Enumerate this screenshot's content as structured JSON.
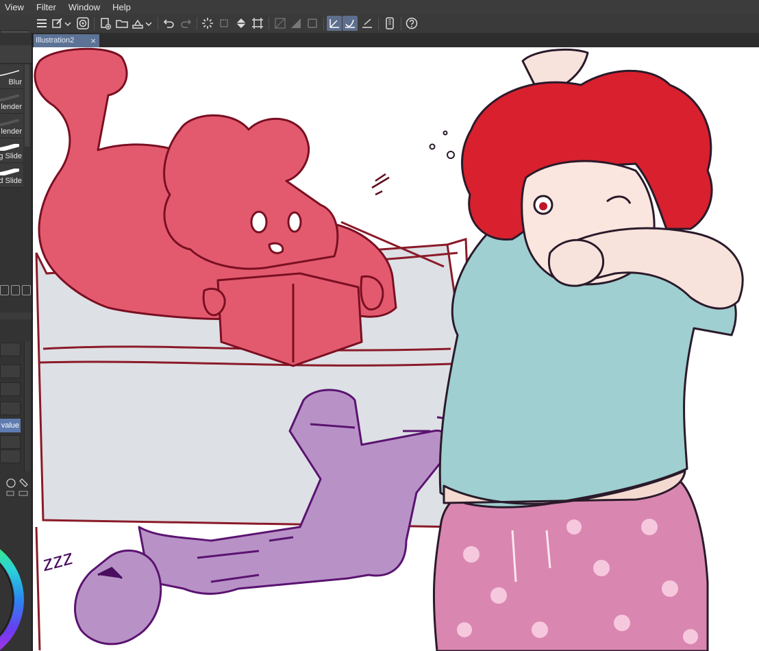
{
  "menu": {
    "items": [
      "View",
      "Filter",
      "Window",
      "Help"
    ]
  },
  "document_tab": {
    "title": "Illustration2",
    "close": "×"
  },
  "brushes": [
    {
      "label": "Blur"
    },
    {
      "label": "lender"
    },
    {
      "label": "lender"
    },
    {
      "label": "g Slide"
    },
    {
      "label": "d Slide"
    }
  ],
  "tool_property": {
    "selected_value": "value"
  },
  "doodle_text": "zzz",
  "colors": {
    "menubar": "#3c3c3c",
    "toolbar": "#3a3a3a",
    "tab_active": "#5c7396",
    "canvas": "#ffffff",
    "red_sketch": "#e35a6e",
    "purple_sketch": "#b890c4",
    "bed_gray": "#d9dde2",
    "shirt": "#9fcfd0",
    "hair": "#d8202e",
    "pants": "#d987b0"
  },
  "icons": [
    "hamburger-menu-icon",
    "pen-settings-icon",
    "spiral-icon",
    "new-file-icon",
    "open-folder-icon",
    "save-icon",
    "undo-icon",
    "redo-icon",
    "loading-spinner-icon",
    "transform-icon",
    "fill-icon",
    "crop-icon",
    "ruler-icon",
    "gradient-icon",
    "frame-icon",
    "snap-ruler-icon",
    "snap-curve-icon",
    "snap-special-icon",
    "tablet-icon",
    "help-icon"
  ]
}
